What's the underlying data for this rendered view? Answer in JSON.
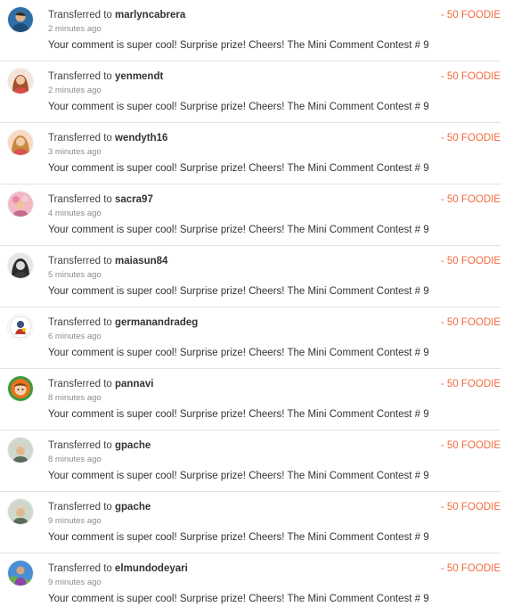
{
  "colors": {
    "amount": "#f26a3d",
    "divider": "#e3e3e3",
    "muted": "#8c8c8c"
  },
  "transfers": [
    {
      "prefix": "Transferred to",
      "user": "marlyncabrera",
      "time": "2 minutes ago",
      "memo": "Your comment is super cool! Surprise prize! Cheers! The Mini Comment Contest # 9",
      "amount": "- 50 FOODIE",
      "avatar_icon": "user-avatar-icon"
    },
    {
      "prefix": "Transferred to",
      "user": "yenmendt",
      "time": "2 minutes ago",
      "memo": "Your comment is super cool! Surprise prize! Cheers! The Mini Comment Contest # 9",
      "amount": "- 50 FOODIE",
      "avatar_icon": "user-avatar-icon"
    },
    {
      "prefix": "Transferred to",
      "user": "wendyth16",
      "time": "3 minutes ago",
      "memo": "Your comment is super cool! Surprise prize! Cheers! The Mini Comment Contest # 9",
      "amount": "- 50 FOODIE",
      "avatar_icon": "user-avatar-icon"
    },
    {
      "prefix": "Transferred to",
      "user": "sacra97",
      "time": "4 minutes ago",
      "memo": "Your comment is super cool! Surprise prize! Cheers! The Mini Comment Contest # 9",
      "amount": "- 50 FOODIE",
      "avatar_icon": "user-avatar-icon"
    },
    {
      "prefix": "Transferred to",
      "user": "maiasun84",
      "time": "5 minutes ago",
      "memo": "Your comment is super cool! Surprise prize! Cheers! The Mini Comment Contest # 9",
      "amount": "- 50 FOODIE",
      "avatar_icon": "user-avatar-icon"
    },
    {
      "prefix": "Transferred to",
      "user": "germanandradeg",
      "time": "6 minutes ago",
      "memo": "Your comment is super cool! Surprise prize! Cheers! The Mini Comment Contest # 9",
      "amount": "- 50 FOODIE",
      "avatar_icon": "user-avatar-icon"
    },
    {
      "prefix": "Transferred to",
      "user": "pannavi",
      "time": "8 minutes ago",
      "memo": "Your comment is super cool! Surprise prize! Cheers! The Mini Comment Contest # 9",
      "amount": "- 50 FOODIE",
      "avatar_icon": "user-avatar-icon"
    },
    {
      "prefix": "Transferred to",
      "user": "gpache",
      "time": "8 minutes ago",
      "memo": "Your comment is super cool! Surprise prize! Cheers! The Mini Comment Contest # 9",
      "amount": "- 50 FOODIE",
      "avatar_icon": "user-avatar-icon"
    },
    {
      "prefix": "Transferred to",
      "user": "gpache",
      "time": "9 minutes ago",
      "memo": "Your comment is super cool! Surprise prize! Cheers! The Mini Comment Contest # 9",
      "amount": "- 50 FOODIE",
      "avatar_icon": "user-avatar-icon"
    },
    {
      "prefix": "Transferred to",
      "user": "elmundodeyari",
      "time": "9 minutes ago",
      "memo": "Your comment is super cool! Surprise prize! Cheers! The Mini Comment Contest # 9",
      "amount": "- 50 FOODIE",
      "avatar_icon": "user-avatar-icon"
    }
  ]
}
